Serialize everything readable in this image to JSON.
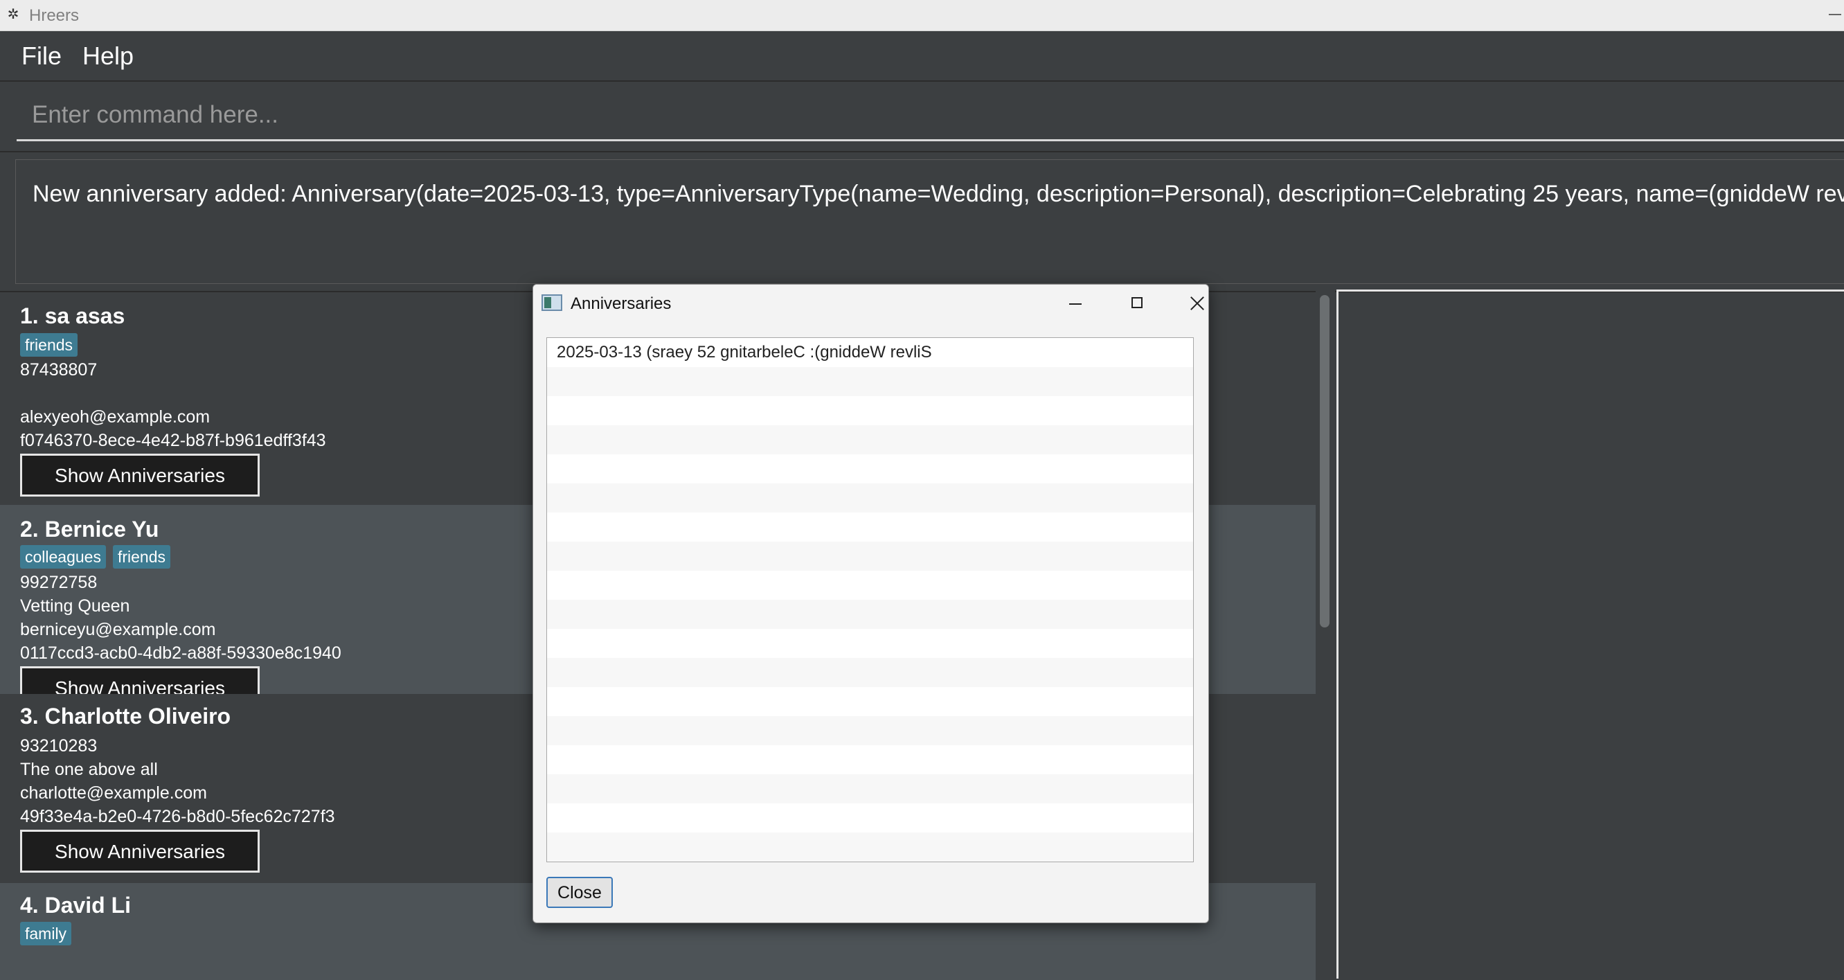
{
  "window": {
    "title": "Hreers"
  },
  "menu": {
    "file": "File",
    "help": "Help"
  },
  "command": {
    "placeholder": "Enter command here..."
  },
  "result": {
    "text": "New anniversary added: Anniversary(date=2025-03-13, type=AnniversaryType(name=Wedding, description=Personal), description=Celebrating 25 years, name=(gniddeW revliS"
  },
  "persons": [
    {
      "name": "1. sa asas",
      "tags": [
        "friends"
      ],
      "phone": "87438807",
      "role": "",
      "email": "alexyeoh@example.com",
      "id": "f0746370-8ece-4e42-b87f-b961edff3f43",
      "button": "Show Anniversaries"
    },
    {
      "name": "2. Bernice Yu",
      "tags": [
        "colleagues",
        "friends"
      ],
      "phone": "99272758",
      "role": "Vetting Queen",
      "email": "berniceyu@example.com",
      "id": "0117ccd3-acb0-4db2-a88f-59330e8c1940",
      "button": "Show Anniversaries"
    },
    {
      "name": "3. Charlotte Oliveiro",
      "tags": [],
      "phone": "93210283",
      "role": "The one above all",
      "email": "charlotte@example.com",
      "id": "49f33e4a-b2e0-4726-b8d0-5fec62c727f3",
      "button": "Show Anniversaries"
    },
    {
      "name": "4. David Li",
      "tags": [
        "family"
      ]
    }
  ],
  "dialog": {
    "title": "Anniversaries",
    "items": [
      "2025-03-13 (sraey 52 gnitarbeleC :(gniddeW revliS"
    ],
    "close_label": "Close"
  }
}
